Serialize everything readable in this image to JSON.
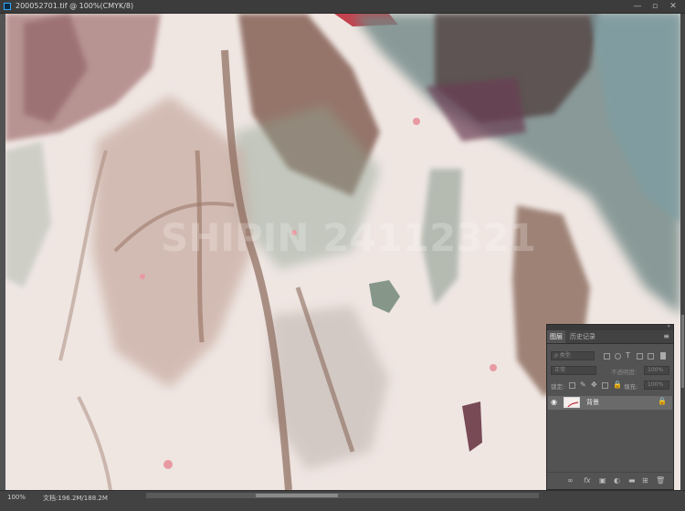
{
  "window": {
    "title": "200052701.tif @ 100%(CMYK/8)",
    "minimize_label": "—",
    "maximize_label": "▫",
    "close_label": "✕"
  },
  "watermark": "SHIPIN  24112321",
  "status": {
    "zoom": "100%",
    "doc": "文档:196.2M/188.2M"
  },
  "layers_panel": {
    "tabs": [
      {
        "label": "图层",
        "active": true
      },
      {
        "label": "历史记录",
        "active": false
      }
    ],
    "collapse_label": "»",
    "menu_label": "≡",
    "filter_placeholder": "ρ 类型",
    "blend_mode": "正常",
    "opacity_label": "不透明度:",
    "opacity_value": "100%",
    "lock_label": "锁定:",
    "fill_label": "填充:",
    "fill_value": "100%",
    "layers": [
      {
        "name": "背景",
        "visible": true,
        "locked": true
      }
    ],
    "footer_icons": [
      "link-icon",
      "fx-icon",
      "mask-icon",
      "adjustment-icon",
      "folder-icon",
      "new-layer-icon",
      "trash-icon"
    ]
  },
  "colors": {
    "panel_bg": "#535353",
    "titlebar_bg": "#3c3c3c",
    "canvas_paper": "#efe6e2"
  }
}
